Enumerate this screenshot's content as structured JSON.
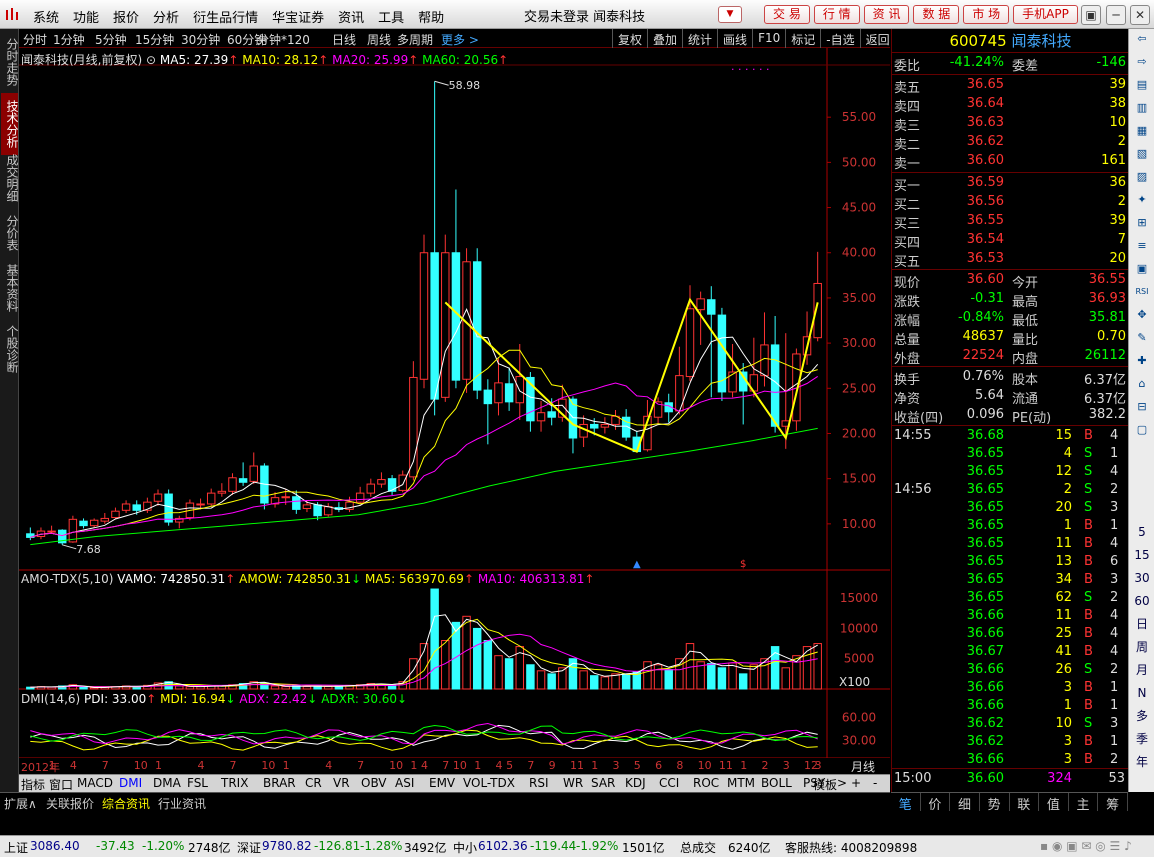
{
  "menubar": {
    "menus": [
      "系统",
      "功能",
      "报价",
      "分析",
      "衍生品行情",
      "华宝证券",
      "资讯",
      "工具",
      "帮助"
    ],
    "title": "交易未登录  闻泰科技",
    "buttons": [
      "交 易",
      "行 情",
      "资 讯",
      "数 据",
      "市 场",
      "手机APP"
    ]
  },
  "left_tabs": [
    "分时走势",
    "技术分析",
    "成交明细",
    "分价表",
    "基本资料",
    "个股诊断"
  ],
  "periods": [
    "分时",
    "1分钟",
    "5分钟",
    "15分钟",
    "30分钟",
    "60分钟",
    "分钟*120",
    "日线",
    "周线",
    "多周期"
  ],
  "periods_more": "更多 >",
  "tools": [
    "复权",
    "叠加",
    "统计",
    "画线",
    "F10",
    "标记",
    "-自选",
    "返回"
  ],
  "main_legend": {
    "name": "闻泰科技(月线,前复权)",
    "ma5": "MA5: 27.39",
    "ma10": "MA10: 28.12",
    "ma20": "MA20: 25.99",
    "ma60": "MA60: 20.56",
    "arrow": "↑"
  },
  "price_axis": [
    "55.00",
    "50.00",
    "45.00",
    "40.00",
    "35.00",
    "30.00",
    "25.00",
    "20.00",
    "15.00",
    "10.00"
  ],
  "max_label": "58.98",
  "min_label": "7.68",
  "vol_legend": {
    "name": "AMO-TDX(5,10)",
    "vamo": "VAMO: 742850.31",
    "amow": "AMOW: 742850.31",
    "ma5": "MA5: 563970.69",
    "ma10": "MA10: 406313.81"
  },
  "vol_axis": [
    "15000",
    "10000",
    "5000"
  ],
  "vol_unit": "X100",
  "dmi_legend": {
    "name": "DMI(14,6)",
    "pdi": "PDI: 33.00",
    "mdi": "MDI: 16.94",
    "adx": "ADX: 22.42",
    "adxr": "ADXR: 30.60"
  },
  "dmi_axis": [
    "60.00",
    "30.00"
  ],
  "time_axis": [
    "2012年",
    "1",
    "4",
    "7",
    "10",
    "1",
    "4",
    "7",
    "10",
    "1",
    "4",
    "7",
    "10",
    "1",
    "4",
    "7",
    "10",
    "1",
    "4",
    "7",
    "10",
    "1",
    "4",
    "7",
    "10",
    "1",
    "4",
    "7",
    "10",
    "1",
    "4",
    "7",
    "10",
    "1",
    "4",
    "7",
    "10",
    "1",
    "4",
    "7",
    "10",
    "1",
    "4",
    "7",
    "10",
    "1",
    "4",
    "7",
    "10",
    "1",
    "4",
    "7",
    "10",
    "1",
    "4",
    "7",
    "10",
    "1",
    "4",
    "7",
    "10",
    "1",
    "4",
    "7",
    "10",
    "1",
    "4",
    "7",
    "10",
    "1",
    "4",
    "7",
    "10",
    "1",
    "4",
    "7",
    "10"
  ],
  "time_labels": [
    {
      "t": "2012年",
      "x": 5
    },
    {
      "t": "1",
      "x": 68
    },
    {
      "t": "4",
      "x": 90
    },
    {
      "t": "7",
      "x": 115
    },
    {
      "t": "10",
      "x": 140
    },
    {
      "t": "1",
      "x": 176
    },
    {
      "t": "4",
      "x": 199
    },
    {
      "t": "7",
      "x": 222
    },
    {
      "t": "10",
      "x": 247
    },
    {
      "t": "1",
      "x": 282
    },
    {
      "t": "4",
      "x": 307
    },
    {
      "t": "7",
      "x": 330
    },
    {
      "t": "10",
      "x": 353
    },
    {
      "t": "1",
      "x": 390
    },
    {
      "t": "4",
      "x": 414
    },
    {
      "t": "7",
      "x": 438
    },
    {
      "t": "10",
      "x": 461
    },
    {
      "t": "1",
      "x": 496
    },
    {
      "t": "4",
      "x": 521
    },
    {
      "t": "7",
      "x": 545
    },
    {
      "t": "10",
      "x": 569
    },
    {
      "t": "1",
      "x": 603
    },
    {
      "t": "4",
      "x": 628
    },
    {
      "t": "7",
      "x": 652
    },
    {
      "t": "10",
      "x": 676
    },
    {
      "t": "1",
      "x": 711
    },
    {
      "t": "4",
      "x": 735
    },
    {
      "t": "7",
      "x": 759
    },
    {
      "t": "10",
      "x": 782
    },
    {
      "t": "1",
      "x": 818
    },
    {
      "t": "4",
      "x": 841
    },
    {
      "t": "7",
      "x": 864
    },
    {
      "t": "10",
      "x": 886
    },
    {
      "t": "1",
      "x": 923
    },
    {
      "t": "4",
      "x": 947
    },
    {
      "t": "7",
      "x": 971
    },
    {
      "t": "10",
      "x": 994
    }
  ],
  "period_label": "月线",
  "indicator_tabs": [
    "指标",
    "窗口",
    "MACD",
    "DMI",
    "DMA",
    "FSL",
    "TRIX",
    "BRAR",
    "CR",
    "VR",
    "OBV",
    "ASI",
    "EMV",
    "VOL-TDX",
    "RSI",
    "WR",
    "SAR",
    "KDJ",
    "CCI",
    "ROC",
    "MTM",
    "BOLL",
    "PSY",
    ">"
  ],
  "template_btn": "模板",
  "plus": "+",
  "minus": "-",
  "ext_tabs": [
    "扩展∧",
    "关联报价",
    "综合资讯",
    "行业资讯"
  ],
  "stock": {
    "code": "600745",
    "name": "闻泰科技"
  },
  "weibi": {
    "l1": "委比",
    "v1": "-41.24%",
    "l2": "委差",
    "v2": "-146"
  },
  "asks": [
    {
      "l": "卖五",
      "p": "36.65",
      "v": "39"
    },
    {
      "l": "卖四",
      "p": "36.64",
      "v": "38"
    },
    {
      "l": "卖三",
      "p": "36.63",
      "v": "10"
    },
    {
      "l": "卖二",
      "p": "36.62",
      "v": "2"
    },
    {
      "l": "卖一",
      "p": "36.60",
      "v": "161"
    }
  ],
  "bids": [
    {
      "l": "买一",
      "p": "36.59",
      "v": "36"
    },
    {
      "l": "买二",
      "p": "36.56",
      "v": "2"
    },
    {
      "l": "买三",
      "p": "36.55",
      "v": "39"
    },
    {
      "l": "买四",
      "p": "36.54",
      "v": "7"
    },
    {
      "l": "买五",
      "p": "36.53",
      "v": "20"
    }
  ],
  "quote": [
    {
      "l1": "现价",
      "v1": "36.60",
      "l2": "今开",
      "v2": "36.55",
      "c1": "#f33",
      "c2": "#f33"
    },
    {
      "l1": "涨跌",
      "v1": "-0.31",
      "l2": "最高",
      "v2": "36.93",
      "c1": "#0f0",
      "c2": "#f33"
    },
    {
      "l1": "涨幅",
      "v1": "-0.84%",
      "l2": "最低",
      "v2": "35.81",
      "c1": "#0f0",
      "c2": "#0f0"
    },
    {
      "l1": "总量",
      "v1": "48637",
      "l2": "量比",
      "v2": "0.70",
      "c1": "#ff0",
      "c2": "#ff0"
    },
    {
      "l1": "外盘",
      "v1": "22524",
      "l2": "内盘",
      "v2": "26112",
      "c1": "#f33",
      "c2": "#0f0"
    }
  ],
  "fundamentals": [
    {
      "l1": "换手",
      "v1": "0.76%",
      "l2": "股本",
      "v2": "6.37亿"
    },
    {
      "l1": "净资",
      "v1": "5.64",
      "l2": "流通",
      "v2": "6.37亿"
    },
    {
      "l1": "收益(四)",
      "v1": "0.096",
      "l2": "PE(动)",
      "v2": "382.2"
    }
  ],
  "ticks": [
    {
      "t": "14:55",
      "p": "36.68",
      "v": "15",
      "bs": "B",
      "n": "4"
    },
    {
      "t": "",
      "p": "36.65",
      "v": "4",
      "bs": "S",
      "n": "1"
    },
    {
      "t": "",
      "p": "36.65",
      "v": "12",
      "bs": "S",
      "n": "4"
    },
    {
      "t": "14:56",
      "p": "36.65",
      "v": "2",
      "bs": "S",
      "n": "2"
    },
    {
      "t": "",
      "p": "36.65",
      "v": "20",
      "bs": "S",
      "n": "3"
    },
    {
      "t": "",
      "p": "36.65",
      "v": "1",
      "bs": "B",
      "n": "1"
    },
    {
      "t": "",
      "p": "36.65",
      "v": "11",
      "bs": "B",
      "n": "4"
    },
    {
      "t": "",
      "p": "36.65",
      "v": "13",
      "bs": "B",
      "n": "6"
    },
    {
      "t": "",
      "p": "36.65",
      "v": "34",
      "bs": "B",
      "n": "3"
    },
    {
      "t": "",
      "p": "36.65",
      "v": "62",
      "bs": "S",
      "n": "2"
    },
    {
      "t": "",
      "p": "36.66",
      "v": "11",
      "bs": "B",
      "n": "4"
    },
    {
      "t": "",
      "p": "36.66",
      "v": "25",
      "bs": "B",
      "n": "4"
    },
    {
      "t": "",
      "p": "36.67",
      "v": "41",
      "bs": "B",
      "n": "4"
    },
    {
      "t": "",
      "p": "36.66",
      "v": "26",
      "bs": "S",
      "n": "2"
    },
    {
      "t": "",
      "p": "36.66",
      "v": "3",
      "bs": "B",
      "n": "1"
    },
    {
      "t": "",
      "p": "36.66",
      "v": "1",
      "bs": "B",
      "n": "1"
    },
    {
      "t": "",
      "p": "36.62",
      "v": "10",
      "bs": "S",
      "n": "3"
    },
    {
      "t": "",
      "p": "36.62",
      "v": "3",
      "bs": "B",
      "n": "1"
    },
    {
      "t": "",
      "p": "36.66",
      "v": "3",
      "bs": "B",
      "n": "2"
    }
  ],
  "last_tick": {
    "t": "15:00",
    "p": "36.60",
    "v": "324",
    "n": "53"
  },
  "side_tabs": [
    "笔",
    "价",
    "细",
    "势",
    "联",
    "值",
    "主",
    "筹"
  ],
  "right_strip": [
    "⇦",
    "⇨",
    "5",
    "15",
    "30",
    "60",
    "日",
    "周",
    "月",
    "N",
    "多",
    "季",
    "年"
  ],
  "status": {
    "sh_label": "上证",
    "sh_val": "3086.40",
    "sh_chg": "-37.43",
    "sh_pct": "-1.20%",
    "sh_amt": "2748亿",
    "sz_label": "深证",
    "sz_val": "9780.82",
    "sz_chg": "-126.81",
    "sz_pct": "-1.28%",
    "sz_amt": "3492亿",
    "zx_label": "中小",
    "zx_val": "6102.36",
    "zx_chg": "-119.44",
    "zx_pct": "-1.92%",
    "zx_amt": "1501亿",
    "total_label": "总成交",
    "total_val": "6240亿",
    "hotline": "客服热线: 4008209898"
  },
  "chart_data": {
    "type": "candlestick",
    "title": "闻泰科技(月线,前复权)",
    "ylim": [
      6,
      60
    ],
    "max": 58.98,
    "min": 7.68,
    "candles": [
      [
        8.9,
        8.5,
        9.6,
        8.2
      ],
      [
        8.6,
        9.2,
        9.6,
        8.3
      ],
      [
        9.1,
        9.2,
        9.8,
        8.9
      ],
      [
        9.3,
        7.9,
        9.4,
        7.68
      ],
      [
        8.0,
        10.5,
        10.9,
        7.9
      ],
      [
        10.3,
        9.8,
        10.6,
        9.5
      ],
      [
        9.8,
        10.4,
        10.6,
        9.6
      ],
      [
        10.3,
        10.6,
        11.2,
        10.0
      ],
      [
        10.7,
        11.4,
        11.8,
        10.5
      ],
      [
        11.5,
        12.2,
        12.6,
        11.2
      ],
      [
        12.1,
        11.5,
        12.6,
        11.0
      ],
      [
        11.5,
        12.4,
        12.9,
        11.2
      ],
      [
        12.5,
        13.3,
        13.8,
        12.0
      ],
      [
        13.3,
        10.2,
        13.8,
        9.8
      ],
      [
        10.2,
        10.6,
        10.9,
        9.5
      ],
      [
        10.7,
        12.3,
        12.7,
        10.4
      ],
      [
        12.1,
        12.2,
        12.8,
        11.6
      ],
      [
        12.2,
        13.4,
        13.9,
        11.9
      ],
      [
        13.4,
        13.6,
        14.5,
        13.0
      ],
      [
        13.6,
        15.1,
        15.6,
        13.2
      ],
      [
        15.0,
        14.6,
        16.8,
        14.2
      ],
      [
        14.7,
        16.4,
        17.9,
        14.4
      ],
      [
        16.4,
        12.3,
        16.7,
        11.6
      ],
      [
        12.2,
        12.9,
        13.5,
        11.8
      ],
      [
        12.9,
        13.0,
        13.8,
        12.1
      ],
      [
        13.0,
        11.6,
        13.7,
        11.1
      ],
      [
        11.7,
        12.1,
        12.6,
        11.3
      ],
      [
        12.1,
        10.9,
        12.4,
        10.4
      ],
      [
        11.0,
        11.9,
        12.3,
        10.8
      ],
      [
        11.8,
        11.6,
        12.4,
        11.3
      ],
      [
        11.6,
        12.4,
        13.0,
        11.3
      ],
      [
        12.4,
        13.4,
        14.1,
        12.2
      ],
      [
        13.4,
        14.4,
        15.0,
        13.0
      ],
      [
        14.4,
        14.9,
        15.7,
        14.0
      ],
      [
        15.0,
        13.6,
        15.4,
        13.2
      ],
      [
        13.7,
        15.4,
        15.9,
        13.5
      ],
      [
        15.2,
        26.2,
        28.0,
        14.8
      ],
      [
        26.0,
        40.0,
        42.0,
        25.0
      ],
      [
        40.0,
        23.8,
        58.98,
        22.0
      ],
      [
        24.0,
        40.0,
        42.0,
        23.5
      ],
      [
        40.0,
        25.9,
        47.0,
        25.0
      ],
      [
        26.0,
        39.0,
        40.5,
        24.5
      ],
      [
        39.0,
        24.8,
        40.5,
        23.8
      ],
      [
        24.8,
        23.3,
        26.0,
        18.8
      ],
      [
        23.4,
        25.6,
        28.3,
        22.0
      ],
      [
        25.5,
        23.5,
        27.3,
        22.5
      ],
      [
        23.4,
        26.3,
        29.9,
        21.5
      ],
      [
        26.2,
        21.4,
        26.8,
        20.2
      ],
      [
        21.4,
        22.3,
        23.6,
        20.2
      ],
      [
        22.4,
        21.8,
        23.9,
        20.9
      ],
      [
        21.8,
        23.8,
        25.4,
        21.3
      ],
      [
        23.8,
        19.5,
        24.1,
        17.8
      ],
      [
        19.6,
        21.0,
        22.0,
        18.5
      ],
      [
        21.0,
        20.6,
        21.7,
        19.8
      ],
      [
        20.7,
        21.0,
        21.8,
        20.0
      ],
      [
        21.0,
        21.9,
        22.6,
        20.4
      ],
      [
        21.8,
        19.6,
        22.7,
        19.2
      ],
      [
        19.6,
        18.0,
        20.3,
        17.9
      ],
      [
        18.2,
        21.9,
        23.7,
        18.0
      ],
      [
        21.8,
        23.5,
        24.0,
        21.1
      ],
      [
        23.4,
        22.4,
        24.4,
        21.2
      ],
      [
        22.5,
        26.4,
        29.6,
        22.1
      ],
      [
        26.3,
        33.8,
        36.4,
        25.8
      ],
      [
        33.7,
        34.9,
        35.7,
        29.8
      ],
      [
        34.8,
        33.2,
        36.3,
        24.0
      ],
      [
        33.1,
        24.6,
        33.9,
        23.6
      ],
      [
        24.6,
        26.8,
        29.9,
        24.0
      ],
      [
        26.8,
        24.7,
        27.8,
        21.0
      ],
      [
        24.7,
        26.5,
        30.6,
        24.0
      ],
      [
        26.4,
        29.8,
        33.4,
        25.2
      ],
      [
        29.8,
        20.8,
        33.0,
        20.1
      ],
      [
        20.8,
        21.4,
        31.1,
        18.3
      ],
      [
        21.4,
        28.8,
        29.4,
        20.3
      ],
      [
        28.7,
        30.7,
        33.5,
        27.6
      ],
      [
        30.6,
        36.6,
        40.1,
        30.2
      ]
    ],
    "ma60_samples": [
      7.7,
      8.6,
      9.2,
      9.8,
      10.4,
      11.0,
      12.3,
      14.2,
      15.8,
      16.9,
      18.0,
      19.2,
      20.56
    ],
    "volume": {
      "ylim": [
        0,
        17000
      ],
      "unit": "X100"
    },
    "dmi": {
      "ylim": [
        10,
        75
      ]
    }
  }
}
